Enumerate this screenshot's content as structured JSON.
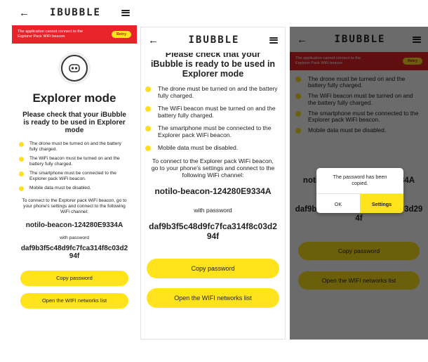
{
  "app": {
    "logo_text": "IBUBBLE"
  },
  "alert": {
    "message": "The application cannot connect to the Explorer Pack WiFi beacon",
    "retry_label": "Retry"
  },
  "page": {
    "title": "Explorer mode",
    "subtitle": "Please check that your iBubble is ready to be used in Explorer mode",
    "checklist": [
      "The drone must be turned on and the battery fully charged.",
      "The WiFi beacon must be turned on and the battery fully charged.",
      "The smartphone must be connected to the Explorer pack WiFi beacon.",
      "Mobile data must be disabled."
    ],
    "instructions_short": "To connect to the Explorer pack WiFi beacon, go to your phone's settings and connect to the following WiFi channel:",
    "network_name": "notilo-beacon-124280E9334A",
    "with_password_label": "with password",
    "password": "daf9b3f5c48d9fc7fca314f8c03d294f",
    "copy_password_label": "Copy password",
    "open_wifi_label": "Open the WIFI networks list"
  },
  "dialog": {
    "message": "The password has been copied.",
    "ok_label": "OK",
    "settings_label": "Settings"
  },
  "colors": {
    "accent_yellow": "#ffe31c",
    "alert_red": "#e8232a",
    "overlay": "rgba(0,0,0,0.58)"
  }
}
